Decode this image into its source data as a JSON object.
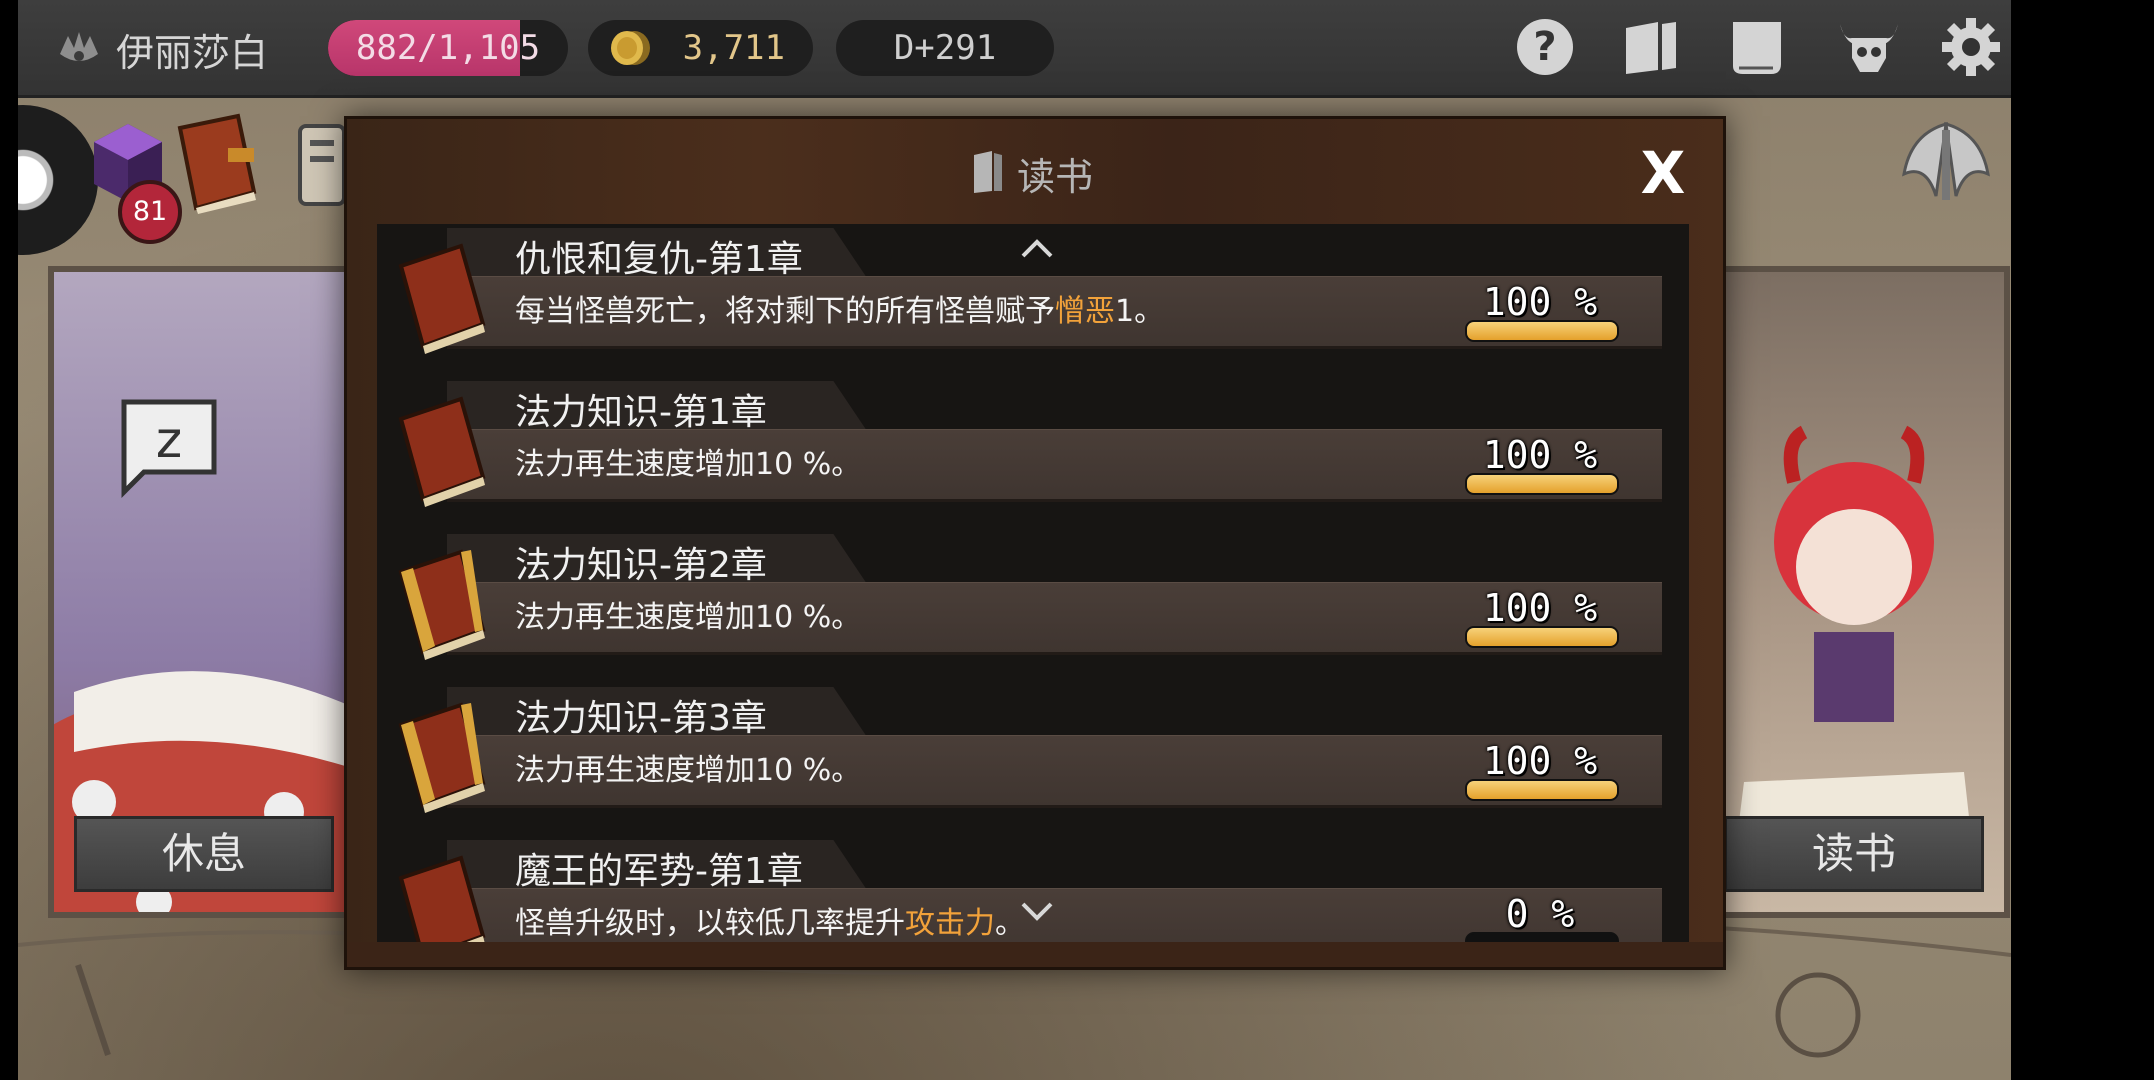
{
  "topbar": {
    "player_name": "伊丽莎白",
    "hp": "882/1,105",
    "hp_current": 882,
    "hp_max": 1105,
    "gold": "3,711",
    "day": "D+291",
    "buttons": [
      "help-icon",
      "book-open-icon",
      "scroll-icon",
      "demon-skull-icon",
      "gear-icon"
    ]
  },
  "side": {
    "cube_badge": "81"
  },
  "rooms": {
    "left_label": "休息",
    "right_label": "读书"
  },
  "modal": {
    "title": "读书",
    "close_label": "X",
    "entries": [
      {
        "title": "仇恨和复仇-第1章",
        "desc_before": "每当怪兽死亡，将对剩下的所有怪兽赋予",
        "desc_highlight": "憎恶",
        "desc_after": "1。",
        "percent_label": "100 %",
        "progress": 100
      },
      {
        "title": "法力知识-第1章",
        "desc_before": "法力再生速度增加10 %。",
        "desc_highlight": "",
        "desc_after": "",
        "percent_label": "100 %",
        "progress": 100
      },
      {
        "title": "法力知识-第2章",
        "desc_before": "法力再生速度增加10 %。",
        "desc_highlight": "",
        "desc_after": "",
        "percent_label": "100 %",
        "progress": 100
      },
      {
        "title": "法力知识-第3章",
        "desc_before": "法力再生速度增加10 %。",
        "desc_highlight": "",
        "desc_after": "",
        "percent_label": "100 %",
        "progress": 100
      },
      {
        "title": "魔王的军势-第1章",
        "desc_before": "怪兽升级时，以较低几率提升",
        "desc_highlight": "攻击力",
        "desc_after": "。",
        "percent_label": "0 %",
        "progress": 0
      }
    ]
  },
  "colors": {
    "hp": "#c93f74",
    "highlight": "#f2a23a",
    "progress": "#f0b94a"
  }
}
